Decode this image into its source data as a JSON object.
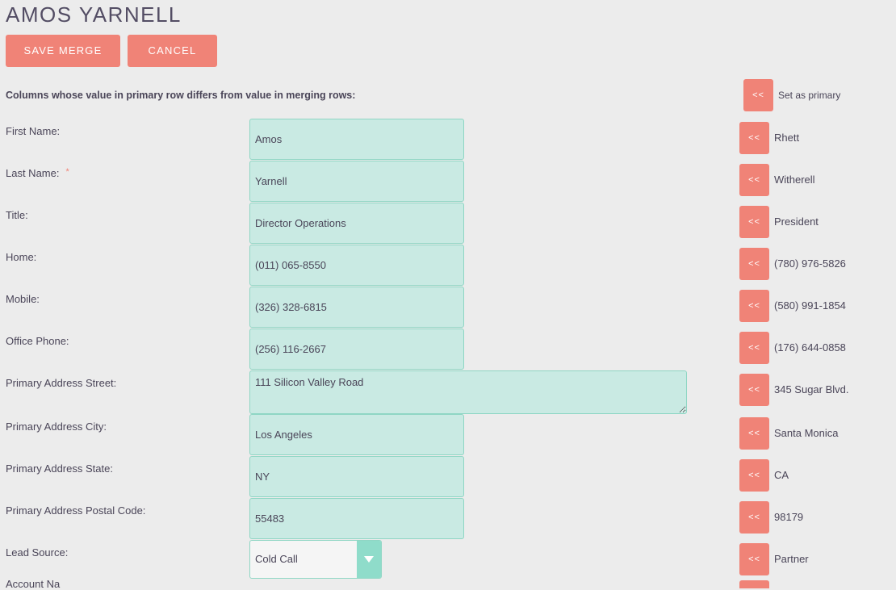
{
  "page": {
    "title": "AMOS YARNELL"
  },
  "toolbar": {
    "save_label": "SAVE MERGE",
    "cancel_label": "CANCEL"
  },
  "merge": {
    "instruction": "Columns whose value in primary row differs from value in merging rows:",
    "set_primary_button": "<<",
    "set_primary_label": "Set as primary",
    "copy_button": "<<",
    "fields": [
      {
        "label": "First Name:",
        "required": false,
        "primary": "Amos",
        "merge": "Rhett",
        "kind": "input"
      },
      {
        "label": "Last Name:",
        "required": true,
        "primary": "Yarnell",
        "merge": "Witherell",
        "kind": "input"
      },
      {
        "label": "Title:",
        "required": false,
        "primary": "Director Operations",
        "merge": "President",
        "kind": "input"
      },
      {
        "label": "Home:",
        "required": false,
        "primary": "(011) 065-8550",
        "merge": "(780) 976-5826",
        "kind": "input"
      },
      {
        "label": "Mobile:",
        "required": false,
        "primary": "(326) 328-6815",
        "merge": "(580) 991-1854",
        "kind": "input"
      },
      {
        "label": "Office Phone:",
        "required": false,
        "primary": "(256) 116-2667",
        "merge": "(176) 644-0858",
        "kind": "input"
      },
      {
        "label": "Primary Address Street:",
        "required": false,
        "primary": "111 Silicon Valley Road",
        "merge": "345 Sugar Blvd.",
        "kind": "textarea"
      },
      {
        "label": "Primary Address City:",
        "required": false,
        "primary": "Los Angeles",
        "merge": "Santa Monica",
        "kind": "input"
      },
      {
        "label": "Primary Address State:",
        "required": false,
        "primary": "NY",
        "merge": "CA",
        "kind": "input"
      },
      {
        "label": "Primary Address Postal Code:",
        "required": false,
        "primary": "55483",
        "merge": "98179",
        "kind": "input"
      },
      {
        "label": "Lead Source:",
        "required": false,
        "primary": "Cold Call",
        "merge": "Partner",
        "kind": "select"
      }
    ],
    "required_marker": "*",
    "cut_off_label": "Account Na"
  },
  "colors": {
    "accent": "#f08377",
    "field_bg": "#c9eae3",
    "field_border": "#8fd6c4",
    "page_bg": "#ececec"
  }
}
